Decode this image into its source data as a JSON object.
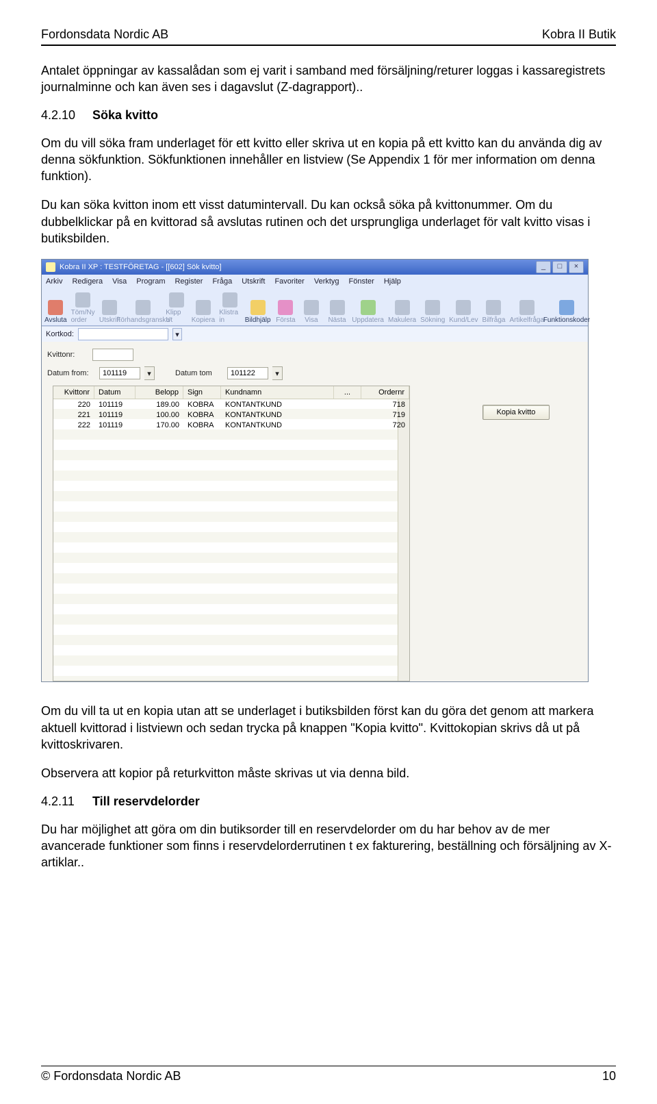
{
  "header": {
    "left": "Fordonsdata Nordic AB",
    "right": "Kobra II Butik"
  },
  "p1": "Antalet öppningar av kassalådan som ej varit i samband med försäljning/returer loggas i kassaregistrets journalminne och kan även ses i dagavslut (Z-dagrapport)..",
  "sec1": {
    "num": "4.2.10",
    "title": "Söka kvitto"
  },
  "p2": "Om du vill söka fram underlaget för ett kvitto eller skriva ut en kopia på ett kvitto kan du använda dig av denna sökfunktion. Sökfunktionen innehåller en listview (Se Appendix 1 för mer information om denna funktion).",
  "p3": "Du kan söka kvitton inom ett visst datumintervall. Du kan också söka på kvittonummer. Om du dubbelklickar på en kvittorad så avslutas rutinen och det ursprungliga underlaget för valt kvitto visas i butiksbilden.",
  "p4": "Om du vill ta ut en kopia utan att se underlaget i butiksbilden först kan du göra det genom att markera aktuell kvittorad i listviewn och sedan trycka på knappen \"Kopia kvitto\". Kvittokopian skrivs då ut på kvittoskrivaren.",
  "p5": "Observera att kopior på returkvitton måste skrivas ut via denna bild.",
  "sec2": {
    "num": "4.2.11",
    "title": "Till reservdelorder"
  },
  "p6": "Du har möjlighet att göra om din butiksorder till en reservdelorder om du har behov av de mer avancerade funktioner som finns i reservdelorderrutinen t ex fakturering, beställning och försäljning av X-artiklar..",
  "footer": {
    "left": "© Fordonsdata Nordic AB",
    "right": "10"
  },
  "app": {
    "title": "Kobra II XP : TESTFÖRETAG - [[602] Sök kvitto]",
    "menu": [
      "Arkiv",
      "Redigera",
      "Visa",
      "Program",
      "Register",
      "Fråga",
      "Utskrift",
      "Favoriter",
      "Verktyg",
      "Fönster",
      "Hjälp"
    ],
    "toolbar": [
      "Avsluta",
      "Töm/Ny order",
      "Utskrift",
      "Förhandsgranska",
      "Klipp Ut",
      "Kopiera",
      "Klistra in",
      "Bildhjälp",
      "Första",
      "Visa",
      "Nästa",
      "Uppdatera",
      "Makulera",
      "Sökning",
      "Kund/Lev",
      "Bilfråga",
      "Artikelfråga",
      "Funktionskoder"
    ],
    "kortkod_label": "Kortkod:",
    "form": {
      "kvittonr_label": "Kvittonr:",
      "datum_from_label": "Datum from:",
      "datum_from": "101119",
      "datum_tom_label": "Datum tom",
      "datum_tom": "101122"
    },
    "cols": [
      "Kvittonr",
      "Datum",
      "Belopp",
      "Sign",
      "Kundnamn",
      "...",
      "Ordernr"
    ],
    "rows": [
      {
        "kv": "220",
        "dt": "101119",
        "bp": "189.00",
        "sg": "KOBRA",
        "kn": "KONTANTKUND",
        "or": "718"
      },
      {
        "kv": "221",
        "dt": "101119",
        "bp": "100.00",
        "sg": "KOBRA",
        "kn": "KONTANTKUND",
        "or": "719"
      },
      {
        "kv": "222",
        "dt": "101119",
        "bp": "170.00",
        "sg": "KOBRA",
        "kn": "KONTANTKUND",
        "or": "720"
      }
    ],
    "kopia_btn": "Kopia kvitto"
  }
}
